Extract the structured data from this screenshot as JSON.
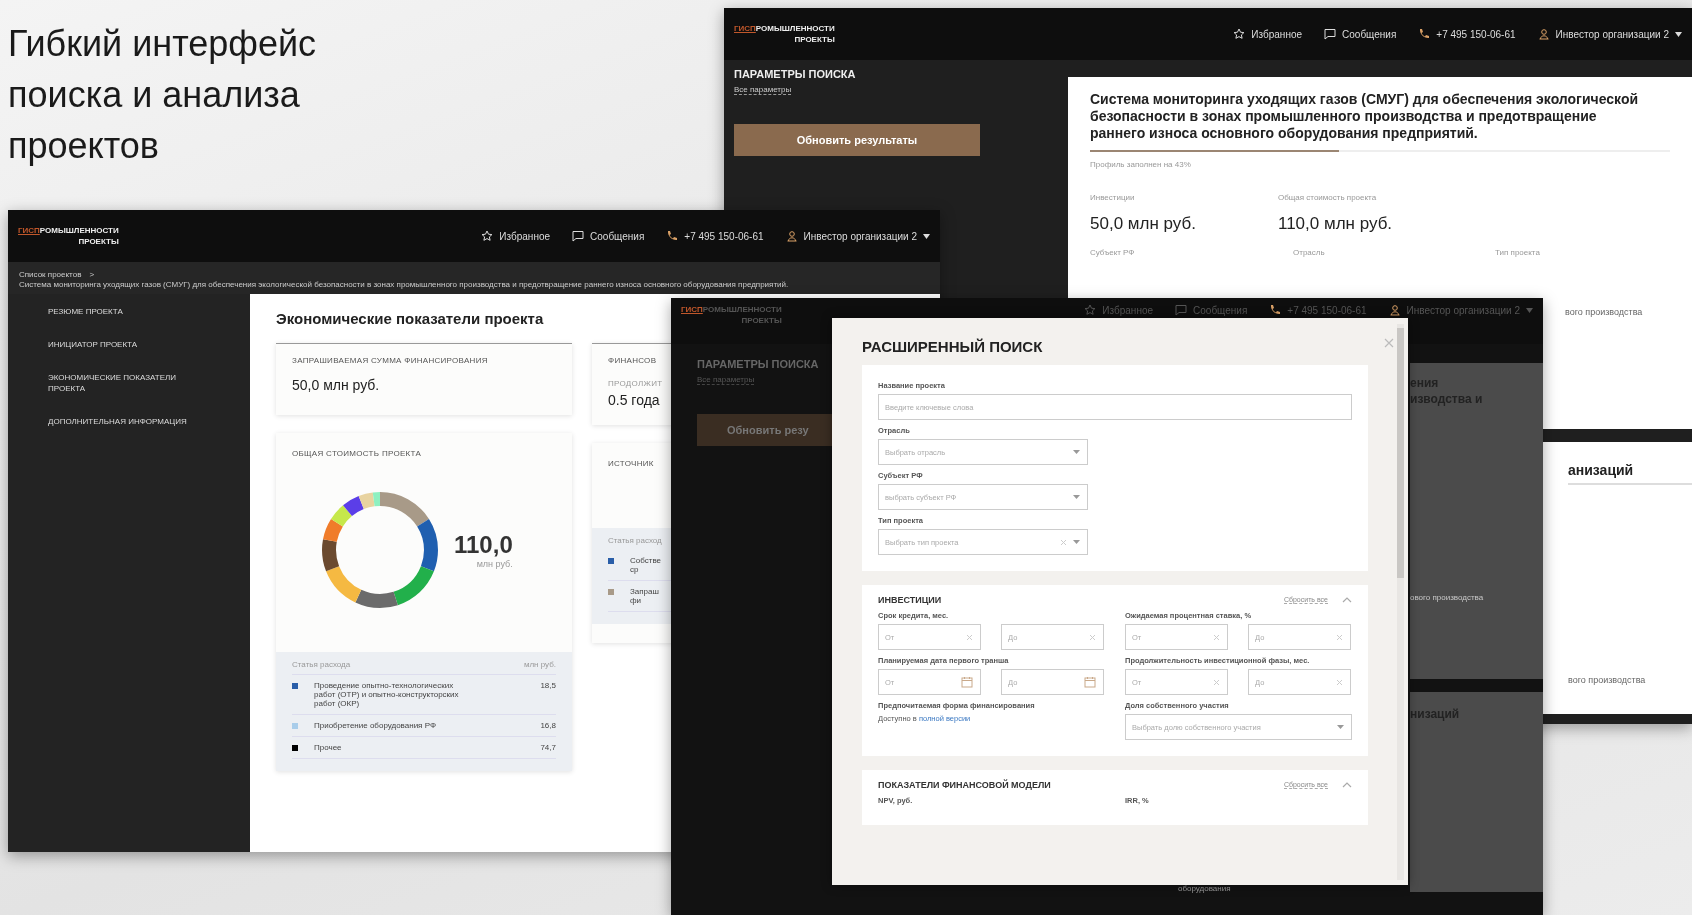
{
  "slide_title": "Гибкий интерфейс поиска и анализа проектов",
  "search_page": {
    "header": {
      "logo_mark": "ГИСП",
      "logo_top": "РОМЫШЛЕННОСТИ",
      "logo_bottom": "ПРОЕКТЫ",
      "nav": [
        {
          "kind": "favorites",
          "label": "Избранное"
        },
        {
          "kind": "messages",
          "label": "Сообщения"
        },
        {
          "kind": "phone",
          "label": "+7 495 150-06-61"
        },
        {
          "kind": "user",
          "label": "Инвестор организации 2"
        }
      ]
    },
    "search_panel": {
      "title": "ПАРАМЕТРЫ ПОИСКА",
      "link": "Все параметры",
      "button": "Обновить результаты"
    },
    "project_card": {
      "title": "Система мониторинга уходящих газов (СМУГ) для обеспечения экологической безопасности в зонах промышленного производства и предотвращение раннего износа основного оборудования предприятий.",
      "profile": {
        "level": 0.43,
        "label": "Профиль заполнен на 43%"
      },
      "fields": [
        {
          "label": "Инвестиции",
          "value": "50,0 млн руб."
        },
        {
          "label": "Общая стоимость проекта",
          "value": "110,0 млн руб."
        }
      ],
      "labels": [
        "Субъект РФ",
        "Отрасль",
        "Тип проекта"
      ],
      "tail": "вого производства"
    },
    "second_card": {
      "heading": "анизаций",
      "tail": "вого производства"
    }
  },
  "project_page": {
    "header": {
      "logo_mark": "ГИСП",
      "logo_top": "РОМЫШЛЕННОСТИ",
      "logo_bottom": "ПРОЕКТЫ",
      "nav": [
        {
          "kind": "favorites",
          "label": "Избранное"
        },
        {
          "kind": "messages",
          "label": "Сообщения"
        },
        {
          "kind": "phone",
          "label": "+7 495 150-06-61"
        },
        {
          "kind": "user",
          "label": "Инвестор организации 2"
        }
      ]
    },
    "breadcrumb": {
      "link": "Список проектов",
      "separator": ">"
    },
    "project_title": "Система мониторинга уходящих газов (СМУГ) для обеспечения экологической безопасности в зонах промышленного производства и предотвращение раннего износа основного оборудования предприятий.",
    "sidebar": [
      "РЕЗЮМЕ ПРОЕКТА",
      "ИНИЦИАТОР ПРОЕКТА",
      "ЭКОНОМИЧЕСКИЕ ПОКАЗАТЕЛИ ПРОЕКТА",
      "ДОПОЛНИТЕЛЬНАЯ ИНФОРМАЦИЯ"
    ],
    "section_title": "Экономические показатели проекта",
    "requested": {
      "label": "ЗАПРАШИВАЕМАЯ СУММА ФИНАНСИРОВАНИЯ",
      "value": "50,0 млн руб."
    },
    "financing": {
      "label": "ФИНАНСОВ",
      "sublabel": "ПРОДОЛЖИТ",
      "value": "0.5 года"
    },
    "total_cost": {
      "label": "ОБЩАЯ СТОИМОСТЬ ПРОЕКТА",
      "value": "110,0",
      "unit": "млн руб.",
      "legend_header": [
        "Статья расхода",
        "млн руб."
      ],
      "rows": [
        {
          "name": "Проведение опытно-технологических работ (ОТР) и опытно-конструкторских работ (ОКР)",
          "value": "18,5",
          "color": "#2a5ea8"
        },
        {
          "name": "Приобретение оборудования РФ",
          "value": "16,8",
          "color": "#a9cdea"
        },
        {
          "name": "Прочее",
          "value": "74,7",
          "color": "#000000"
        }
      ]
    },
    "sources": {
      "label": "ИСТОЧНИК",
      "legend_header": "Статья расход",
      "rows": [
        {
          "name": "Собстве ср",
          "color": "#2a5ea8"
        },
        {
          "name": "Запраш фи",
          "color": "#a89a88"
        }
      ]
    }
  },
  "overlay_page": {
    "header": {
      "logo_mark": "ГИСП",
      "logo_top": "РОМЫШЛЕННОСТИ",
      "logo_bottom": "ПРОЕКТЫ",
      "nav": [
        {
          "kind": "favorites",
          "label": "Избранное"
        },
        {
          "kind": "messages",
          "label": "Сообщения"
        },
        {
          "kind": "phone",
          "label": "+7 495 150-06-61"
        },
        {
          "kind": "user",
          "label": "Инвестор организации 2"
        }
      ]
    },
    "search_panel": {
      "title": "ПАРАМЕТРЫ ПОИСКА",
      "link": "Все параметры",
      "button": "Обновить резу"
    },
    "fragments": [
      "ения",
      "изводства и",
      "ового производства"
    ],
    "heading": "низаций",
    "bottom_text": "оборудования"
  },
  "advanced_search": {
    "title": "РАСШИРЕННЫЙ ПОИСК",
    "fields": [
      {
        "kind": "input",
        "label": "Название проекта",
        "placeholder": "Введите ключевые слова"
      },
      {
        "kind": "select",
        "label": "Отрасль",
        "placeholder": "Выбрать отрасль",
        "clearable": false
      },
      {
        "kind": "select",
        "label": "Субъект РФ",
        "placeholder": "выбрать субъект РФ",
        "clearable": false
      },
      {
        "kind": "select",
        "label": "Тип проекта",
        "placeholder": "Выбрать тип проекта",
        "clearable": true
      }
    ],
    "sections": [
      {
        "title": "ИНВЕСТИЦИИ",
        "reset": "Сбросить все",
        "expanded": true,
        "fields": [
          {
            "kind": "range",
            "label": "Срок кредита, мес.",
            "from_placeholder": "От",
            "to_placeholder": "До"
          },
          {
            "kind": "range",
            "label": "Ожидаемая процентная ставка, %",
            "from_placeholder": "От",
            "to_placeholder": "До"
          },
          {
            "kind": "date_range",
            "label": "Планируемая дата первого транша",
            "from_placeholder": "От",
            "to_placeholder": "До"
          },
          {
            "kind": "range",
            "label": "Продолжительность инвестиционной фазы, мес.",
            "from_placeholder": "От",
            "to_placeholder": "До"
          },
          {
            "kind": "note",
            "label": "Предпочитаемая форма финансирования",
            "text": "Доступно в",
            "link": "полной версии"
          },
          {
            "kind": "select",
            "label": "Доля собственного участия",
            "placeholder": "Выбрать долю собственного участия"
          }
        ]
      },
      {
        "title": "ПОКАЗАТЕЛИ ФИНАНСОВОЙ МОДЕЛИ",
        "reset": "Сбросить все",
        "expanded": true,
        "fields": [
          {
            "kind": "label",
            "label": "NPV, руб."
          },
          {
            "kind": "label",
            "label": "IRR, %"
          }
        ]
      }
    ]
  }
}
